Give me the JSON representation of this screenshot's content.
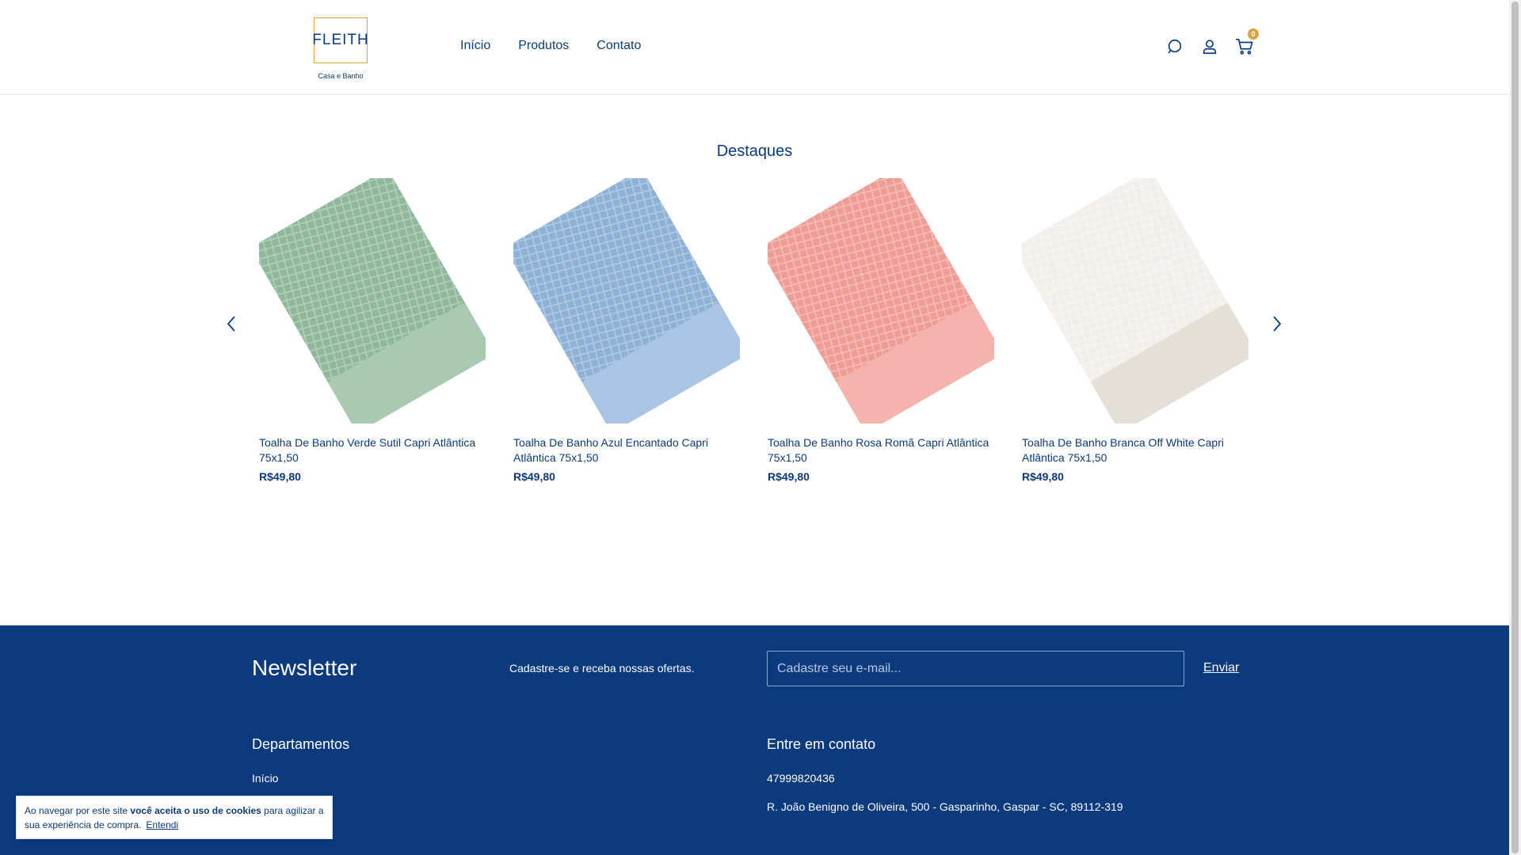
{
  "header": {
    "logo_text": "FLEITH",
    "logo_sub": "Casa e Banho",
    "nav": [
      {
        "label": "Início"
      },
      {
        "label": "Produtos"
      },
      {
        "label": "Contato"
      }
    ],
    "cart_count": "0"
  },
  "section": {
    "title": "Destaques"
  },
  "products": [
    {
      "name": "Toalha De Banho Verde Sutil Capri Atlântica 75x1,50",
      "price": "R$49,80",
      "color": "#8fb79a",
      "border": "#a9c9b1"
    },
    {
      "name": "Toalha De Banho Azul Encantado Capri Atlântica 75x1,50",
      "price": "R$49,80",
      "color": "#8eb1d6",
      "border": "#a9c5e3"
    },
    {
      "name": "Toalha De Banho Rosa Romã Capri Atlântica 75x1,50",
      "price": "R$49,80",
      "color": "#ef9c95",
      "border": "#f4b3ad"
    },
    {
      "name": "Toalha De Banho Branca Off White Capri Atlântica 75x1,50",
      "price": "R$49,80",
      "color": "#f2efea",
      "border": "#e4e0d8"
    }
  ],
  "newsletter": {
    "title": "Newsletter",
    "text": "Cadastre-se e receba nossas ofertas.",
    "placeholder": "Cadastre seu e-mail...",
    "button": "Enviar"
  },
  "footer": {
    "departments_title": "Departamentos",
    "departments": [
      {
        "label": "Início"
      }
    ],
    "contact_title": "Entre em contato",
    "phone": "47999820436",
    "address": "R. João Benigno de Oliveira, 500 - Gasparinho, Gaspar - SC, 89112-319"
  },
  "cookie": {
    "text_before": "Ao navegar por este site ",
    "text_bold": "você aceita o uso de cookies",
    "text_after": " para agilizar a sua experiência de compra.",
    "button": "Entendi"
  },
  "colors": {
    "brand_blue": "#0b3a7e",
    "accent_gold": "#d9a444"
  }
}
